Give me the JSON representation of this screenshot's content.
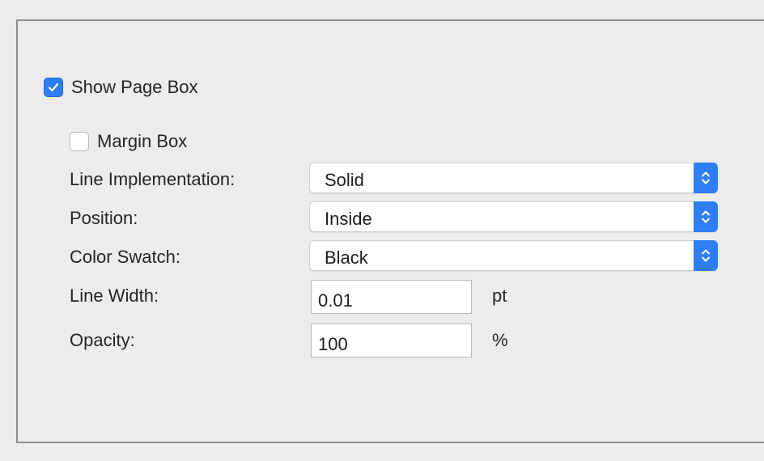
{
  "show_page_box": {
    "label": "Show Page Box",
    "checked": true
  },
  "margin_box": {
    "label": "Margin Box",
    "checked": false
  },
  "line_implementation": {
    "label": "Line Implementation:",
    "value": "Solid"
  },
  "position": {
    "label": "Position:",
    "value": "Inside"
  },
  "color_swatch": {
    "label": "Color Swatch:",
    "value": "Black"
  },
  "line_width": {
    "label": "Line Width:",
    "value": "0.01",
    "unit": "pt"
  },
  "opacity": {
    "label": "Opacity:",
    "value": "100",
    "unit": "%"
  },
  "colors": {
    "accent": "#2f7ff7",
    "panel_border": "#8e8e8e",
    "background": "#ececec"
  }
}
